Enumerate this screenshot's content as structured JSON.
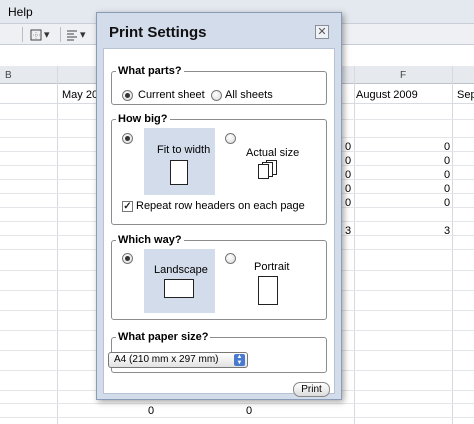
{
  "menubar": {
    "help": "Help"
  },
  "toolbar": {
    "borders_icon": "borders-icon",
    "align_icon": "align-icon"
  },
  "sheet": {
    "col_b": "B",
    "col_f": "F",
    "hdr_may": "May 20",
    "hdr_august": "August 2009",
    "hdr_sep": "Sep",
    "left_values": [
      "0",
      "0",
      "0",
      "0",
      "0",
      "3"
    ],
    "right_values": [
      "0",
      "0",
      "0",
      "0",
      "0",
      "3"
    ],
    "bottom_values": [
      "0",
      "0"
    ]
  },
  "dialog": {
    "title": "Print Settings",
    "close": "✕",
    "parts": {
      "legend": "What parts?",
      "current_sheet": "Current sheet",
      "all_sheets": "All sheets",
      "selected": "current_sheet"
    },
    "size": {
      "legend": "How big?",
      "fit_to_width": "Fit to width",
      "actual_size": "Actual size",
      "repeat_headers": "Repeat row headers on each page",
      "repeat_checked": true,
      "selected": "fit_to_width"
    },
    "orientation": {
      "legend": "Which way?",
      "landscape": "Landscape",
      "portrait": "Portrait",
      "selected": "landscape"
    },
    "paper": {
      "legend": "What paper size?",
      "selected": "A4 (210 mm x 297 mm)"
    },
    "print_button": "Print"
  },
  "colors": {
    "dialog_bg": "#d3dceb",
    "selected_option_bg": "#d3dceb"
  }
}
